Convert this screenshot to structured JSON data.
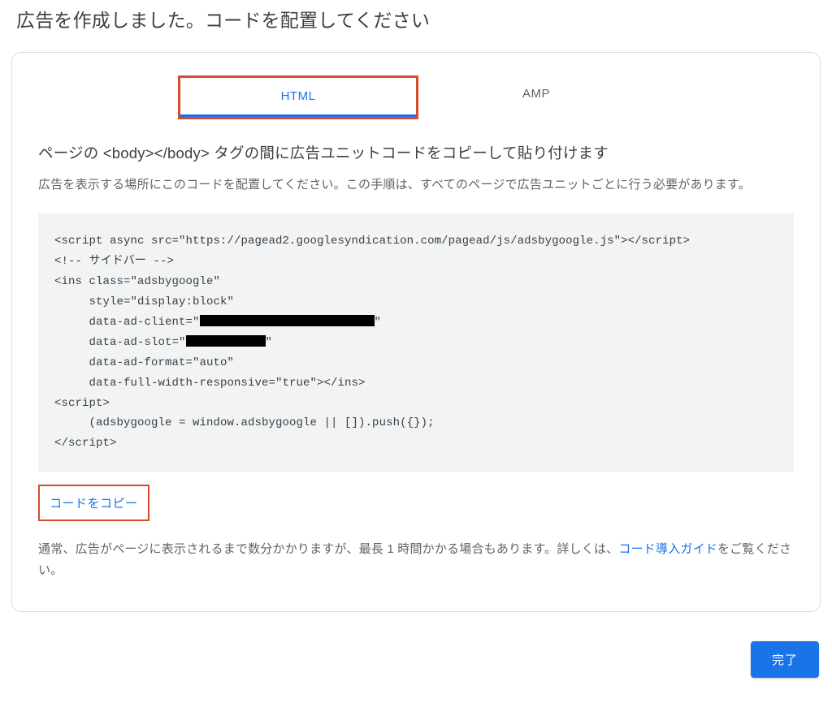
{
  "page": {
    "title": "広告を作成しました。コードを配置してください"
  },
  "tabs": {
    "html": "HTML",
    "amp": "AMP"
  },
  "section": {
    "title": "ページの <body></body> タグの間に広告ユニットコードをコピーして貼り付けます",
    "desc": "広告を表示する場所にこのコードを配置してください。この手順は、すべてのページで広告ユニットごとに行う必要があります。"
  },
  "code": {
    "l1": "<script async src=\"https://pagead2.googlesyndication.com/pagead/js/adsbygoogle.js\"></script>",
    "l2": "<!-- サイドバー -->",
    "l3": "<ins class=\"adsbygoogle\"",
    "l4": "     style=\"display:block\"",
    "l5a": "     data-ad-client=\"",
    "l5b": "\"",
    "l6a": "     data-ad-slot=\"",
    "l6b": "\"",
    "l7": "     data-ad-format=\"auto\"",
    "l8": "     data-full-width-responsive=\"true\"></ins>",
    "l9": "<script>",
    "l10": "     (adsbygoogle = window.adsbygoogle || []).push({});",
    "l11": "</script>"
  },
  "actions": {
    "copy": "コードをコピー",
    "done": "完了"
  },
  "footer": {
    "part1": "通常、広告がページに表示されるまで数分かかりますが、最長 1 時間かかる場合もあります。詳しくは、",
    "link": "コード導入ガイド",
    "part2": "をご覧ください。"
  }
}
